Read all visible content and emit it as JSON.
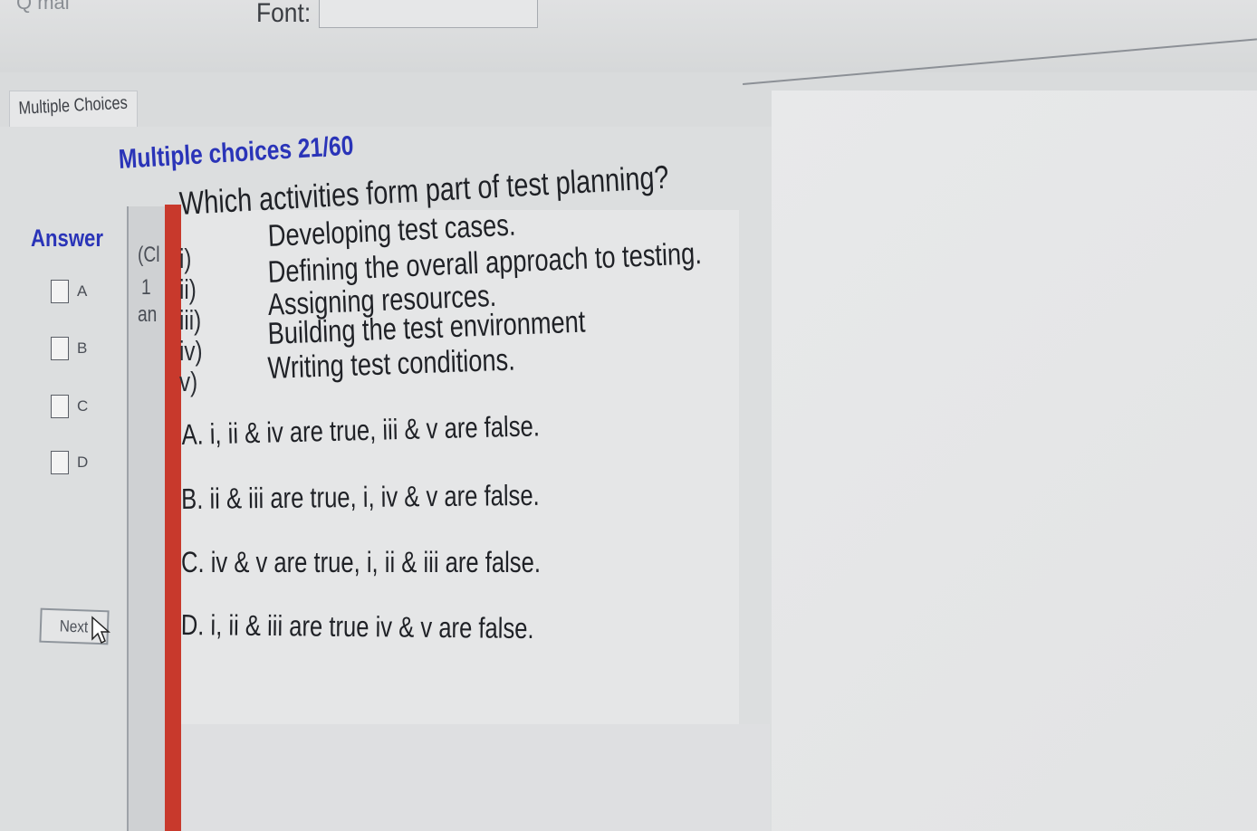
{
  "toolbar": {
    "menu_partial": "Q mai",
    "font_label": "Font:",
    "font_value": ""
  },
  "section_tab": {
    "label": "Multiple Choices"
  },
  "heading": "Multiple choices 21/60",
  "answer": {
    "label": "Answer",
    "choices": [
      "A",
      "B",
      "C",
      "D"
    ]
  },
  "next_button": {
    "label": "Next"
  },
  "clipped_column": [
    "(Cl",
    "1",
    "an"
  ],
  "question": {
    "text": "Which activities form part of test planning?",
    "statements": [
      {
        "num": "i)",
        "text": "Developing test cases."
      },
      {
        "num": "ii)",
        "text": "Defining the overall approach to testing."
      },
      {
        "num": "iii)",
        "text": "Assigning resources."
      },
      {
        "num": "iv)",
        "text": "Building the test environment"
      },
      {
        "num": "v)",
        "text": "Writing test conditions."
      }
    ],
    "options": [
      "A.  i, ii & iv are true, iii & v are false.",
      "B.  ii & iii are true, i, iv & v are false.",
      "C.  iv & v are true, i, ii & iii are false.",
      "D.  i, ii & iii are true iv & v are false."
    ]
  },
  "colors": {
    "heading": "#2a34b8",
    "accent_red": "#c8392c",
    "text": "#1f2126"
  },
  "icons": [
    "pointer-cursor-icon"
  ]
}
